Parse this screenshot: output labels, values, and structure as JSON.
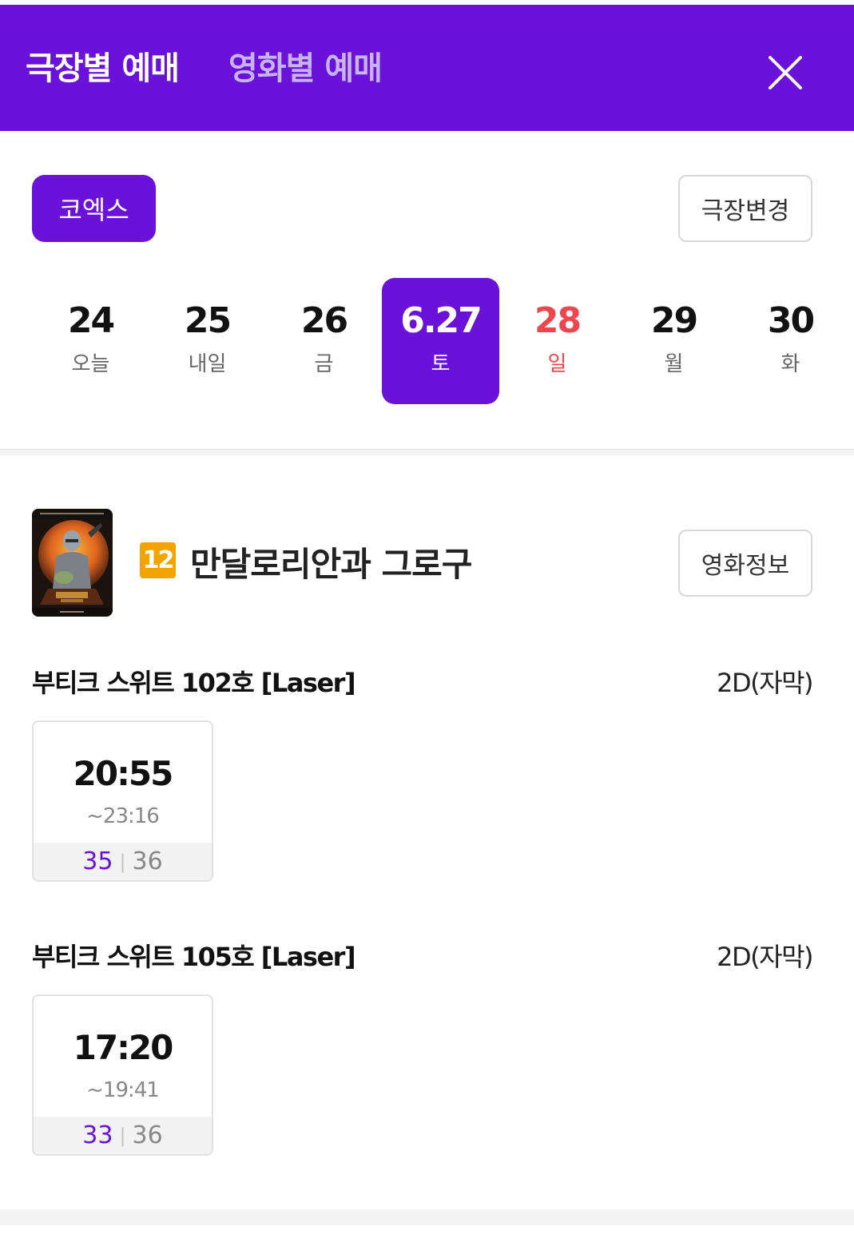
{
  "header": {
    "tab_theater": "극장별 예매",
    "tab_movie": "영화별 예매",
    "close_icon": "close-icon",
    "background_color": "#6a12d9"
  },
  "theater": {
    "name": "코엑스",
    "change_label": "극장변경"
  },
  "dates": [
    {
      "num": "24",
      "day": "오늘",
      "selected": false,
      "sunday": false
    },
    {
      "num": "25",
      "day": "내일",
      "selected": false,
      "sunday": false
    },
    {
      "num": "26",
      "day": "금",
      "selected": false,
      "sunday": false
    },
    {
      "num": "6.27",
      "day": "토",
      "selected": true,
      "sunday": false
    },
    {
      "num": "28",
      "day": "일",
      "selected": false,
      "sunday": true
    },
    {
      "num": "29",
      "day": "월",
      "selected": false,
      "sunday": false
    },
    {
      "num": "30",
      "day": "화",
      "selected": false,
      "sunday": false
    }
  ],
  "movie": {
    "rating": "12",
    "title": "만달로리안과 그로구",
    "info_label": "영화정보"
  },
  "screens": [
    {
      "name": "부티크 스위트 102호 [Laser]",
      "format": "2D(자막)",
      "showtimes": [
        {
          "start": "20:55",
          "end": "~23:16",
          "available": "35",
          "total": "36"
        }
      ]
    },
    {
      "name": "부티크 스위트 105호 [Laser]",
      "format": "2D(자막)",
      "showtimes": [
        {
          "start": "17:20",
          "end": "~19:41",
          "available": "33",
          "total": "36"
        }
      ]
    }
  ],
  "colors": {
    "accent": "#6a12d9",
    "sunday": "#f0454d",
    "rating_12": "#f2a400"
  }
}
